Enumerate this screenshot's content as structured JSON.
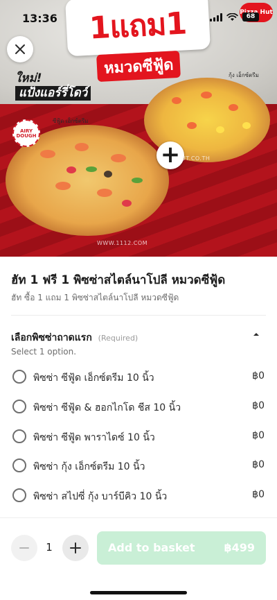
{
  "status_bar": {
    "time": "13:36",
    "battery": "68"
  },
  "hero": {
    "headline": "1แถม1",
    "subheadline": "หมวดซีฟู้ด",
    "new_line1": "ใหม่!",
    "new_line2": "แป้งแอร์รี่โดว์",
    "seal": "AIRY DOUGH",
    "logo": "Pizza Hut",
    "pizza_left_label": "ซีฟู้ด เอ็กซ์ตรีม",
    "pizza_right_label": "กุ้ง เอ็กซ์ตรีม",
    "url_left": "WWW.1112.COM",
    "url_right": "UT.CO.TH"
  },
  "item": {
    "title": "ฮัท 1 ฟรี 1 พิซซ่าสไตล์นาโปลี หมวดซีฟู้ด",
    "description": "ฮัท ซื้อ 1 แถม 1 พิซซ่าสไตล์นาโปลี หมวดซีฟู้ด"
  },
  "option_group": {
    "title": "เลือกพิซซ่าถาดแรก",
    "required_label": "(Required)",
    "hint": "Select 1 option.",
    "options": [
      {
        "label": "พิซซ่า ซีฟู้ด เอ็กซ์ตรีม 10 นิ้ว",
        "price": "฿0"
      },
      {
        "label": "พิซซ่า ซีฟู้ด & ฮอกไกโด ชีส 10 นิ้ว",
        "price": "฿0"
      },
      {
        "label": "พิซซ่า ซีฟู้ด พาราไดซ์ 10 นิ้ว",
        "price": "฿0"
      },
      {
        "label": "พิซซ่า กุ้ง เอ็กซ์ตรีม 10 นิ้ว",
        "price": "฿0"
      },
      {
        "label": "พิซซ่า สไปซี่ กุ้ง บาร์บีคิว 10 นิ้ว",
        "price": "฿0"
      }
    ]
  },
  "footer": {
    "quantity": "1",
    "add_label": "Add to basket",
    "add_price": "฿499"
  },
  "colors": {
    "add_button_disabled": "#c9efd6",
    "brand_red": "#e3151e",
    "text_primary": "#1c1c1c",
    "text_secondary": "#6c6c6c"
  },
  "icons": {
    "close": "close-icon",
    "collapse": "chevron-up-icon",
    "minus": "minus-icon",
    "plus": "plus-icon",
    "radio": "radio-unchecked-icon"
  }
}
